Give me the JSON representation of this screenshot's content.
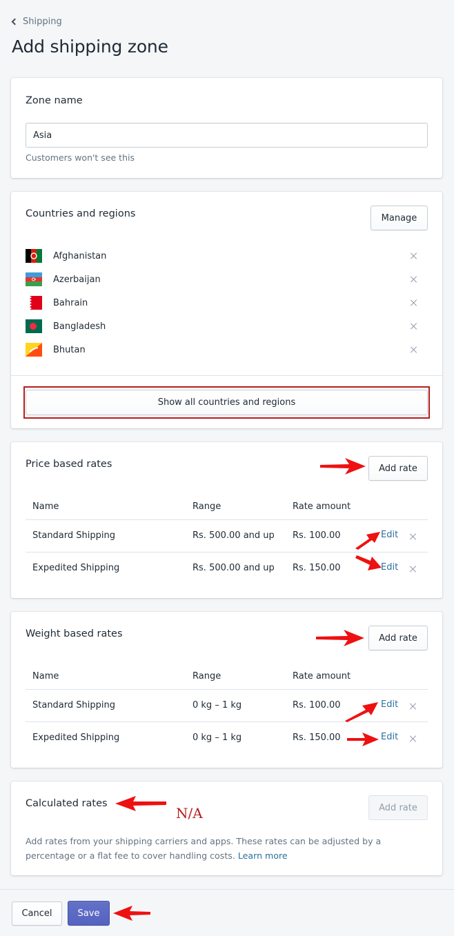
{
  "breadcrumb": {
    "label": "Shipping",
    "icon": "chevron-left-icon"
  },
  "page_title": "Add shipping zone",
  "zone_name": {
    "title": "Zone name",
    "value": "Asia",
    "help_text": "Customers won't see this"
  },
  "countries": {
    "title": "Countries and regions",
    "manage_label": "Manage",
    "items": [
      {
        "name": "Afghanistan",
        "flag": "flag-afghanistan"
      },
      {
        "name": "Azerbaijan",
        "flag": "flag-azerbaijan"
      },
      {
        "name": "Bahrain",
        "flag": "flag-bahrain"
      },
      {
        "name": "Bangladesh",
        "flag": "flag-bangladesh"
      },
      {
        "name": "Bhutan",
        "flag": "flag-bhutan"
      }
    ],
    "show_all_label": "Show all countries and regions"
  },
  "price_rates": {
    "title": "Price based rates",
    "add_label": "Add rate",
    "columns": [
      "Name",
      "Range",
      "Rate amount"
    ],
    "rows": [
      {
        "name": "Standard Shipping",
        "range": "Rs. 500.00 and up",
        "amount": "Rs. 100.00",
        "edit": "Edit"
      },
      {
        "name": "Expedited Shipping",
        "range": "Rs. 500.00 and up",
        "amount": "Rs. 150.00",
        "edit": "Edit"
      }
    ]
  },
  "weight_rates": {
    "title": "Weight based rates",
    "add_label": "Add rate",
    "columns": [
      "Name",
      "Range",
      "Rate amount"
    ],
    "rows": [
      {
        "name": "Standard Shipping",
        "range": "0 kg – 1 kg",
        "amount": "Rs. 100.00",
        "edit": "Edit"
      },
      {
        "name": "Expedited Shipping",
        "range": "0 kg – 1 kg",
        "amount": "Rs. 150.00",
        "edit": "Edit"
      }
    ]
  },
  "calculated_rates": {
    "title": "Calculated rates",
    "add_label": "Add rate",
    "description": "Add rates from your shipping carriers and apps. These rates can be adjusted by a percentage or a flat fee to cover handling costs.",
    "learn_more": "Learn more",
    "annotation": "N/A"
  },
  "footer": {
    "cancel_label": "Cancel",
    "save_label": "Save"
  },
  "colors": {
    "primary": "#5c6ac4",
    "link": "#2b6f9e",
    "annotation": "#e01010",
    "highlight": "#b71c1c"
  }
}
